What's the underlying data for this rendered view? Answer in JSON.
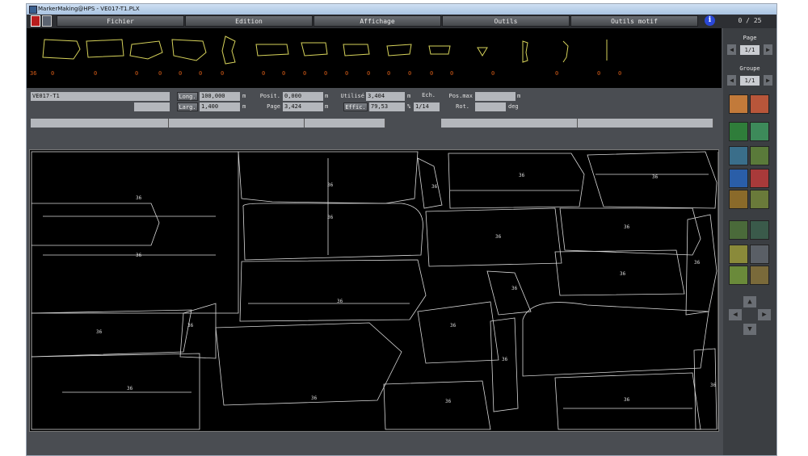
{
  "window": {
    "title": "MarkerMaking@HPS - VE017-T1.PLX"
  },
  "menu": {
    "items": [
      "Fichier",
      "Edition",
      "Affichage",
      "Outils",
      "Outils motif"
    ],
    "counter": "0 / 25"
  },
  "preview": {
    "counts": [
      "36",
      "0",
      "0",
      "0",
      "0",
      "0",
      "0",
      "0",
      "0",
      "0",
      "0",
      "0",
      "0",
      "0",
      "0",
      "0",
      "0",
      "0",
      "0",
      "0",
      "0",
      "0"
    ]
  },
  "fields": {
    "marker_name": "VE017-T1",
    "longueur_label": "Long.",
    "longueur": "100,000",
    "longueur_unit": "m",
    "largeur_label": "Larg.",
    "largeur": "1,400",
    "largeur_unit": "m",
    "position_label": "Posit.",
    "position": "0,000",
    "position_unit": "m",
    "page_label": "Page",
    "page_value": "3,424",
    "page_unit": "m",
    "utilise_label": "Utilisé",
    "utilise": "3,404",
    "utilise_unit": "m",
    "efficacite_label": "Effic.",
    "efficacite": "79,53",
    "efficacite_unit": "%",
    "echelle_label": "Ech.",
    "echelle": "1/14",
    "posmax_label": "Pos.max",
    "posmax_unit": "m",
    "rotation_label": "Rot.",
    "rotation_unit": "deg"
  },
  "side": {
    "page_label": "Page",
    "page_value": "1/1",
    "groupe_label": "Groupe",
    "groupe_value": "1/1"
  },
  "canvas": {
    "size_label": "36"
  },
  "colors": {
    "accent": "#2a48d8",
    "brand": "#b81d1d",
    "piece_outline": "#d8d8d8",
    "preview_outline": "#d6d25a",
    "count_text": "#d65c18"
  }
}
